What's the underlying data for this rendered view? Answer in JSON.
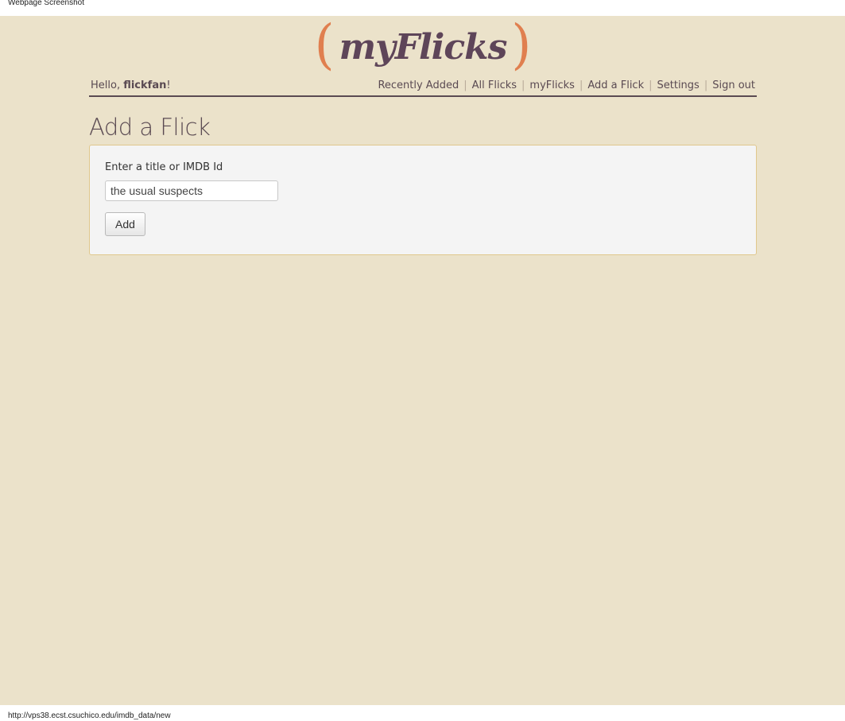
{
  "capture": {
    "header_text": "Webpage Screenshot",
    "footer_url": "http://vps38.ecst.csuchico.edu/imdb_data/new"
  },
  "brand": {
    "open_paren": "(",
    "name": "myFlicks",
    "close_paren": ")",
    "accent_color": "#e07f4f",
    "text_color": "#5e4559"
  },
  "nav": {
    "greeting_prefix": "Hello, ",
    "username": "flickfan",
    "greeting_suffix": "!",
    "links": [
      {
        "label": "Recently Added"
      },
      {
        "label": "All Flicks"
      },
      {
        "label": "myFlicks"
      },
      {
        "label": "Add a Flick"
      },
      {
        "label": "Settings"
      },
      {
        "label": "Sign out"
      }
    ],
    "separator": "|"
  },
  "page": {
    "title": "Add a Flick",
    "background": "#ebe2ca"
  },
  "form": {
    "label": "Enter a title or IMDB Id",
    "input_value": "the usual suspects",
    "submit_label": "Add"
  }
}
